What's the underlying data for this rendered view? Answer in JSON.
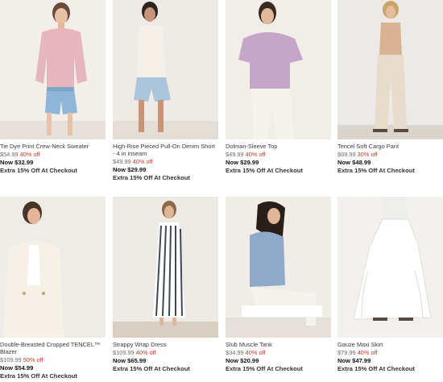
{
  "products": [
    {
      "name": "Tie Dye Print Crew-Neck Sweater",
      "was": "$54.99",
      "off": "40% off",
      "now": "Now $32.99",
      "extra": "Extra 15% Off At Checkout"
    },
    {
      "name": "High-Rise Pieced Pull-On Denim Short - 4 in inseam",
      "was": "$49.99",
      "off": "40% off",
      "now": "Now $29.99",
      "extra": "Extra 15% Off At Checkout"
    },
    {
      "name": "Dolman-Sleeve Top",
      "was": "$49.99",
      "off": "40% off",
      "now": "Now $29.99",
      "extra": "Extra 15% Off At Checkout"
    },
    {
      "name": "Tencel Soft Cargo Pant",
      "was": "$69.99",
      "off": "30% off",
      "now": "Now $48.99",
      "extra": "Extra 15% Off At Checkout"
    },
    {
      "name": "Double-Breasted Cropped TENCEL™ Blazer",
      "was": "$109.99",
      "off": "50% off",
      "now": "Now $54.99",
      "extra": "Extra 15% Off At Checkout"
    },
    {
      "name": "Strappy Wrap Dress",
      "was": "$109.99",
      "off": "40% off",
      "now": "Now $65.99",
      "extra": "Extra 15% Off At Checkout"
    },
    {
      "name": "Slub Muscle Tank",
      "was": "$34.99",
      "off": "40% off",
      "now": "Now $20.99",
      "extra": "Extra 15% Off At Checkout"
    },
    {
      "name": "Gauze Maxi Skirt",
      "was": "$79.99",
      "off": "40% off",
      "now": "Now $47.99",
      "extra": "Extra 15% Off At Checkout"
    }
  ],
  "colors": {
    "sale": "#c0392b",
    "image_bg": "#f3f1ee"
  }
}
